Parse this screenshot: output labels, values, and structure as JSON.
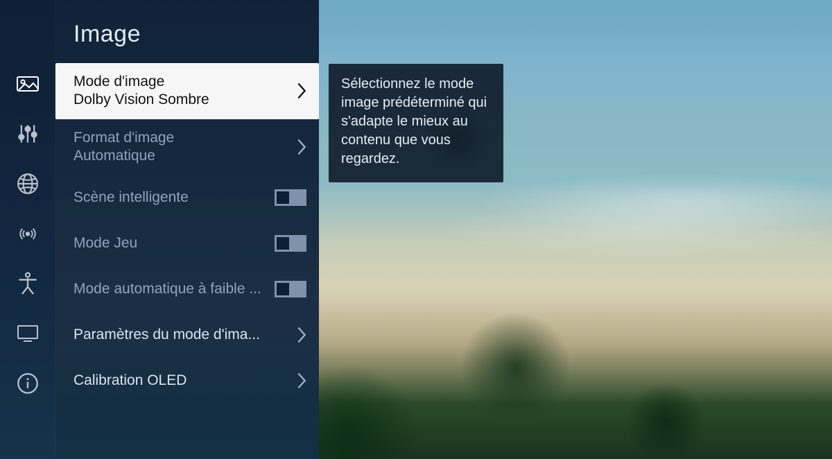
{
  "header": {
    "title": "Image"
  },
  "rail": {
    "items": [
      {
        "name": "image-icon",
        "active": true
      },
      {
        "name": "sliders-icon"
      },
      {
        "name": "globe-icon"
      },
      {
        "name": "broadcast-icon"
      },
      {
        "name": "accessibility-icon"
      },
      {
        "name": "display-icon"
      },
      {
        "name": "info-icon"
      }
    ]
  },
  "menu": {
    "items": [
      {
        "label": "Mode d'image",
        "value": "Dolby Vision Sombre",
        "type": "submenu",
        "selected": true
      },
      {
        "label": "Format d'image",
        "value": "Automatique",
        "type": "submenu",
        "dim": true
      },
      {
        "label": "Scène intelligente",
        "type": "toggle",
        "state": "off",
        "dim": true
      },
      {
        "label": "Mode Jeu",
        "type": "toggle",
        "state": "off",
        "dim": true
      },
      {
        "label": "Mode automatique à faible ...",
        "type": "toggle",
        "state": "off",
        "dim": true
      },
      {
        "label": "Paramètres du mode d'ima...",
        "type": "submenu"
      },
      {
        "label": "Calibration OLED",
        "type": "submenu"
      }
    ]
  },
  "tooltip": {
    "text": "Sélectionnez le mode image prédéterminé qui s'adapte le mieux au contenu que vous regardez."
  }
}
